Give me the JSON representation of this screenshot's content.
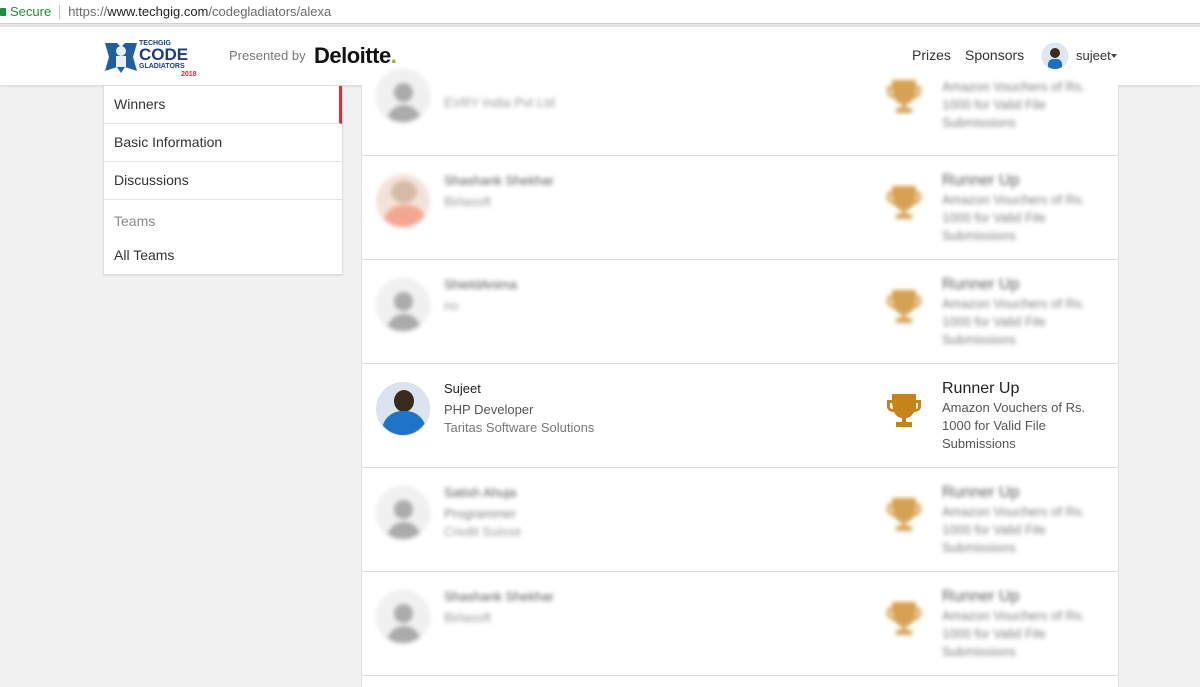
{
  "browser": {
    "secure_label": "Secure",
    "url_scheme": "https://",
    "url_host": "www.techgig.com",
    "url_path": "/codegladiators/alexa"
  },
  "header": {
    "logo_small_text": "TECHGIG",
    "logo_main_text": "CODE",
    "logo_sub_text": "GLADIATORS",
    "logo_year": "2018",
    "presented_by": "Presented by",
    "sponsor_name": "Deloitte",
    "sponsor_dot": ".",
    "nav": {
      "prizes": "Prizes",
      "sponsors": "Sponsors"
    },
    "user": {
      "name": "sujeet"
    }
  },
  "sidebar": {
    "items": [
      {
        "label": "Winners",
        "active": true
      },
      {
        "label": "Basic Information"
      },
      {
        "label": "Discussions"
      }
    ],
    "teams_heading": "Teams",
    "all_teams": "All Teams"
  },
  "winners": [
    {
      "name": "",
      "title": "EVRY India Pvt Ltd",
      "company": "",
      "rank": "",
      "prize": "Amazon Vouchers of Rs. 1000 for Valid File Submissions",
      "blurred": true,
      "avatar": "placeholder"
    },
    {
      "name": "Shashank Shekhar",
      "title": "Birlasoft",
      "company": "",
      "rank": "Runner Up",
      "prize": "Amazon Vouchers of Rs. 1000 for Valid File Submissions",
      "blurred": true,
      "avatar": "photo-orange"
    },
    {
      "name": "ShieldAnima",
      "title": "no",
      "company": "",
      "rank": "Runner Up",
      "prize": "Amazon Vouchers of Rs. 1000 for Valid File Submissions",
      "blurred": true,
      "avatar": "placeholder"
    },
    {
      "name": "Sujeet",
      "title": "PHP Developer",
      "company": "Taritas Software Solutions",
      "rank": "Runner Up",
      "prize": "Amazon Vouchers of Rs. 1000 for Valid File Submissions",
      "blurred": false,
      "avatar": "photo-blue"
    },
    {
      "name": "Satish Ahuja",
      "title": "Programmer",
      "company": "Credit Suisse",
      "rank": "Runner Up",
      "prize": "Amazon Vouchers of Rs. 1000 for Valid File Submissions",
      "blurred": true,
      "avatar": "placeholder"
    },
    {
      "name": "Shashank Shekhar",
      "title": "Birlasoft",
      "company": "",
      "rank": "Runner Up",
      "prize": "Amazon Vouchers of Rs. 1000 for Valid File Submissions",
      "blurred": true,
      "avatar": "placeholder"
    }
  ],
  "colors": {
    "accent_red": "#e02b3a",
    "trophy_gold": "#c8821a",
    "secure_green": "#1e8e3e",
    "deloitte_green": "#86bc25"
  }
}
